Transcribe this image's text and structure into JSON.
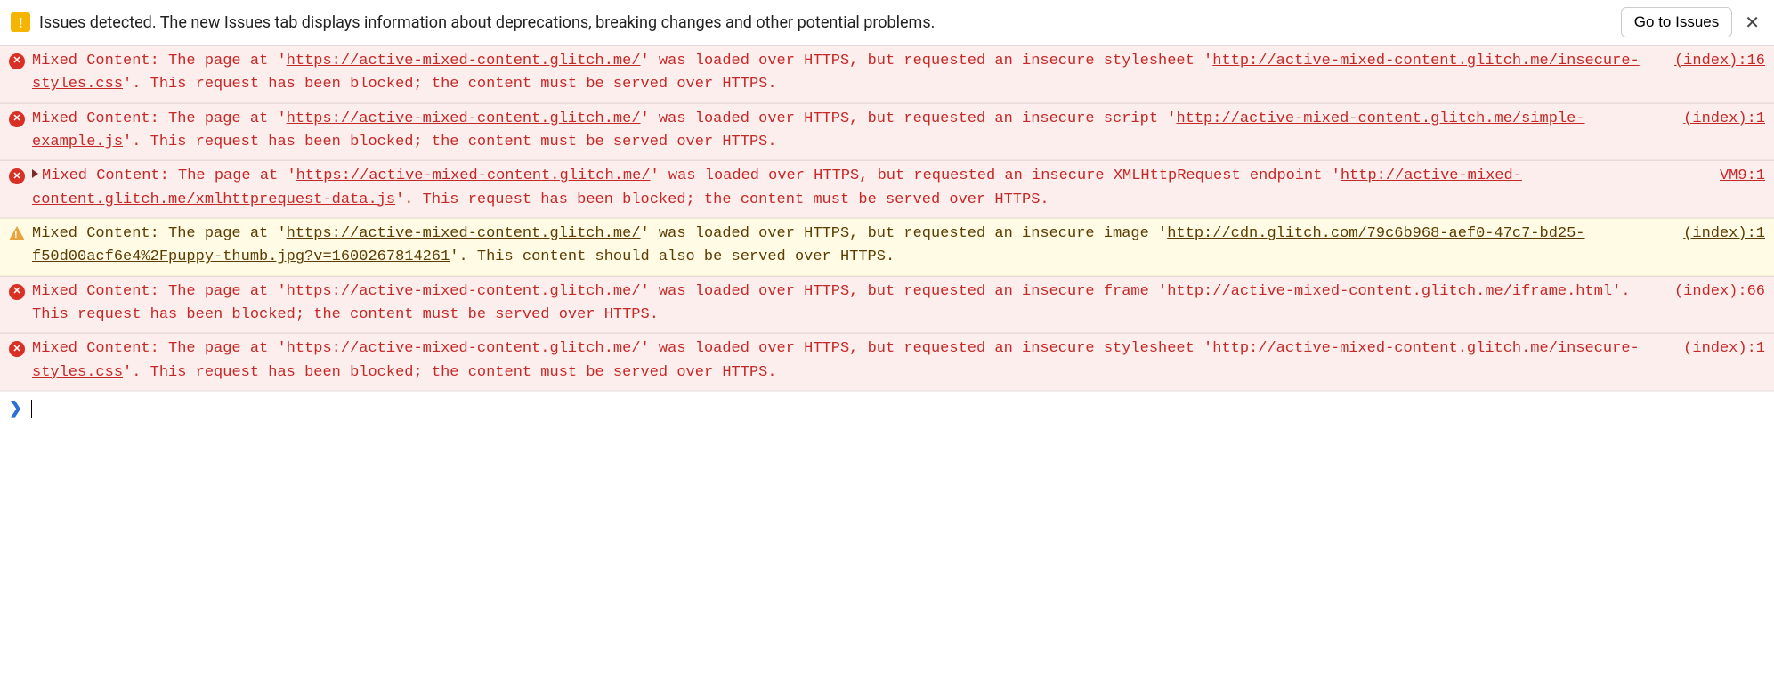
{
  "issues_bar": {
    "text": "Issues detected. The new Issues tab displays information about deprecations, breaking changes and other potential problems.",
    "button": "Go to Issues",
    "close": "✕"
  },
  "page_url": "https://active-mixed-content.glitch.me/",
  "messages": [
    {
      "level": "error",
      "expandable": false,
      "pre": "Mixed Content: The page at '",
      "mid1": "' was loaded over HTTPS, but requested an insecure stylesheet '",
      "resource": "http://active-mixed-content.glitch.me/insecure-styles.css",
      "post": "'. This request has been blocked; the content must be served over HTTPS.",
      "source": "(index):16"
    },
    {
      "level": "error",
      "expandable": false,
      "pre": "Mixed Content: The page at '",
      "mid1": "' was loaded over HTTPS, but requested an insecure script '",
      "resource": "http://active-mixed-content.glitch.me/simple-example.js",
      "post": "'. This request has been blocked; the content must be served over HTTPS.",
      "source": "(index):1"
    },
    {
      "level": "error",
      "expandable": true,
      "pre": "Mixed Content: The page at '",
      "mid1": "' was loaded over HTTPS, but requested an insecure XMLHttpRequest endpoint '",
      "resource": "http://active-mixed-content.glitch.me/xmlhttprequest-data.js",
      "post": "'. This request has been blocked; the content must be served over HTTPS.",
      "source": "VM9:1"
    },
    {
      "level": "warning",
      "expandable": false,
      "pre": "Mixed Content: The page at '",
      "mid1": "' was loaded over HTTPS, but requested an insecure image '",
      "resource": "http://cdn.glitch.com/79c6b968-aef0-47c7-bd25-f50d00acf6e4%2Fpuppy-thumb.jpg?v=1600267814261",
      "post": "'. This content should also be served over HTTPS.",
      "source": "(index):1"
    },
    {
      "level": "error",
      "expandable": false,
      "pre": "Mixed Content: The page at '",
      "mid1": "' was loaded over HTTPS, but requested an insecure frame '",
      "resource": "http://active-mixed-content.glitch.me/iframe.html",
      "post": "'. This request has been blocked; the content must be served over HTTPS.",
      "source": "(index):66"
    },
    {
      "level": "error",
      "expandable": false,
      "pre": "Mixed Content: The page at '",
      "mid1": "' was loaded over HTTPS, but requested an insecure stylesheet '",
      "resource": "http://active-mixed-content.glitch.me/insecure-styles.css",
      "post": "'. This request has been blocked; the content must be served over HTTPS.",
      "source": "(index):1"
    }
  ],
  "prompt": ""
}
